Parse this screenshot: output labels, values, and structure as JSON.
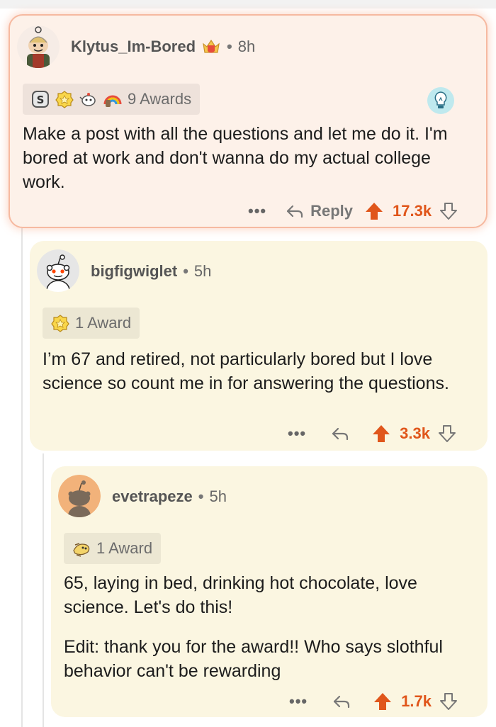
{
  "comments": [
    {
      "username": "Klytus_Im-Bored",
      "time": "8h",
      "awards_label": "9 Awards",
      "award_icons": [
        "silver-award-icon",
        "gold-badge-award-icon",
        "teapot-award-icon",
        "rainbow-award-icon"
      ],
      "user_badge": "crown-shield-icon",
      "text": [
        "Make a post with all the questions and let me do it. I'm bored at work and don't wanna do my actual college work."
      ],
      "reply_label": "Reply",
      "score": "17.3k",
      "highlighted": true,
      "accent": "#f6b9a0"
    },
    {
      "username": "bigfigwiglet",
      "time": "5h",
      "awards_label": "1 Award",
      "award_icons": [
        "gold-badge-award-icon"
      ],
      "text": [
        "I’m 67 and retired, not particularly bored but I love science so count me in for answering the questions."
      ],
      "score": "3.3k"
    },
    {
      "username": "evetrapeze",
      "time": "5h",
      "awards_label": "1 Award",
      "award_icons": [
        "sloth-award-icon"
      ],
      "text": [
        "65, laying in bed, drinking hot chocolate, love science.  Let's do this!",
        "Edit: thank you for the award!! Who says slothful behavior can't be rewarding"
      ],
      "score": "1.7k"
    }
  ],
  "separator": "•",
  "more_label": "•••",
  "colors": {
    "card_bg": "#fbf6e1",
    "highlight_bg": "#fdf1e9",
    "upvote": "#e0561b",
    "muted": "#777777"
  }
}
